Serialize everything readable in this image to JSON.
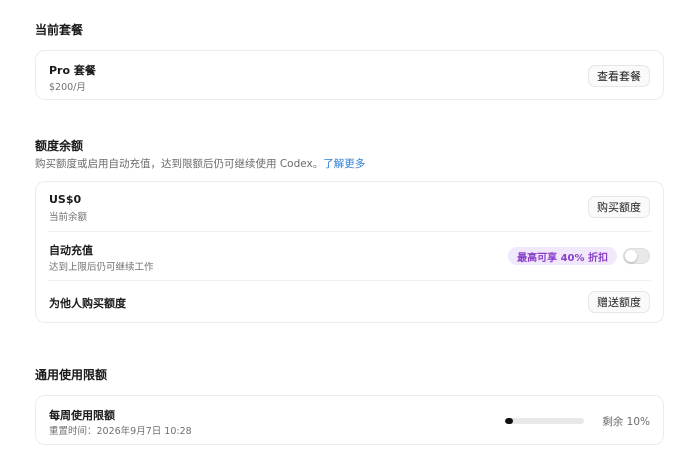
{
  "current_plan": {
    "section_title": "当前套餐",
    "plan_name": "Pro 套餐",
    "plan_price": "$200/月",
    "view_button": "查看套餐"
  },
  "credit_balance": {
    "section_title": "额度余额",
    "description": "购买额度或启用自动充值，达到限额后仍可继续使用 Codex。",
    "learn_more_link": "了解更多",
    "balance": {
      "amount": "US$0",
      "label": "当前余额",
      "buy_button": "购买额度"
    },
    "auto_recharge": {
      "title": "自动充值",
      "subtitle": "达到上限后仍可继续工作",
      "discount_badge": "最高可享 40% 折扣",
      "enabled": false,
      "badge_color": "#8a3fc9"
    },
    "gift": {
      "title": "为他人购买额度",
      "gift_button": "赠送额度"
    }
  },
  "usage_limits": {
    "section_title": "通用使用限额",
    "weekly": {
      "title": "每周使用限额",
      "reset_text": "重置时间：2026年9月7日 10:28",
      "remaining_label": "剩余 10%",
      "used_fraction": 0.1
    }
  },
  "colors": {
    "link": "#2f7fd6",
    "accent_purple": "#8a3fc9",
    "progress_fill": "#111111"
  }
}
